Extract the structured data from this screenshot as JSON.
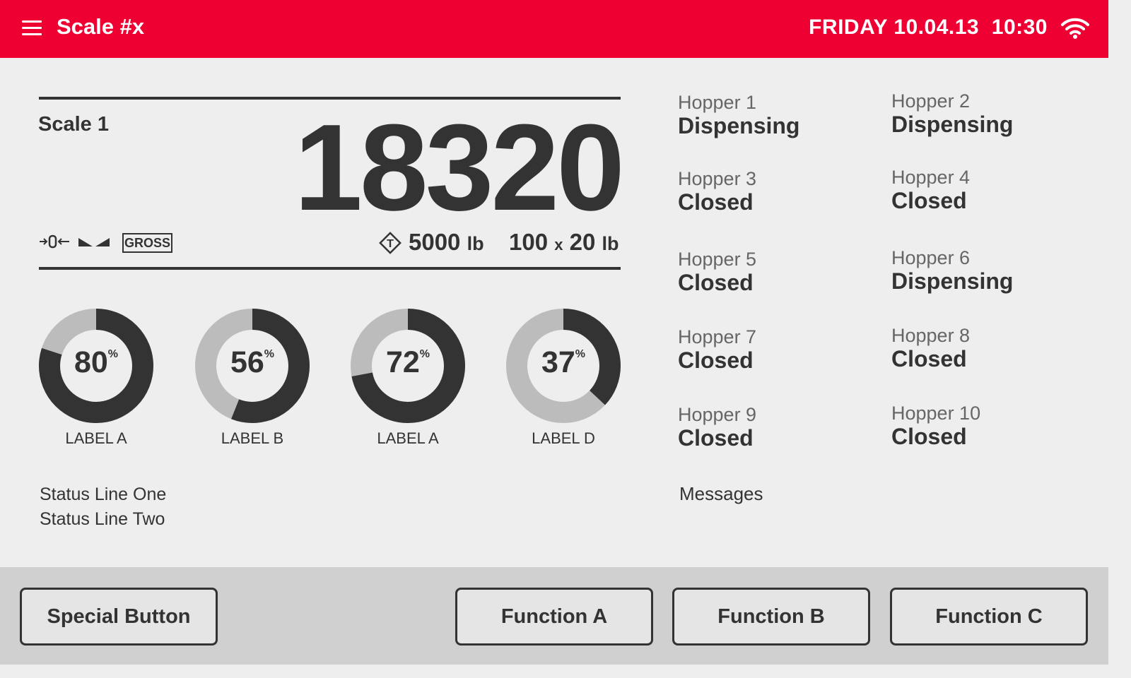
{
  "header": {
    "title": "Scale #x",
    "datetime": "FRIDAY 10.04.13  10:30",
    "wifi_icon": "wifi-icon"
  },
  "scale": {
    "name": "Scale 1",
    "weight": "18320",
    "mode": "GROSS",
    "capacity": "5000",
    "capacity_unit": "lb",
    "divisions": "100",
    "times": "x",
    "division_size": "20",
    "division_unit": "lb",
    "zero_icon": "center-of-zero-icon",
    "stable_icon": "motion-icon",
    "tare_icon": "tare-icon"
  },
  "gauges": [
    {
      "value": 80,
      "display": "80",
      "pct": "%",
      "label": "LABEL A"
    },
    {
      "value": 56,
      "display": "56",
      "pct": "%",
      "label": "LABEL B"
    },
    {
      "value": 72,
      "display": "72",
      "pct": "%",
      "label": "LABEL A"
    },
    {
      "value": 37,
      "display": "37",
      "pct": "%",
      "label": "LABEL D"
    }
  ],
  "status": {
    "line1": "Status Line One",
    "line2": "Status Line Two"
  },
  "hoppers": [
    {
      "name": "Hopper 1",
      "state": "Dispensing"
    },
    {
      "name": "Hopper 2",
      "state": "Dispensing"
    },
    {
      "name": "Hopper 3",
      "state": "Closed"
    },
    {
      "name": "Hopper 4",
      "state": "Closed"
    },
    {
      "name": "Hopper 5",
      "state": "Closed"
    },
    {
      "name": "Hopper 6",
      "state": "Dispensing"
    },
    {
      "name": "Hopper 7",
      "state": "Closed"
    },
    {
      "name": "Hopper 8",
      "state": "Closed"
    },
    {
      "name": "Hopper 9",
      "state": "Closed"
    },
    {
      "name": "Hopper 10",
      "state": "Closed"
    }
  ],
  "messages": "Messages",
  "buttons": {
    "special": "Special Button",
    "function_a": "Function A",
    "function_b": "Function B",
    "function_c": "Function C"
  },
  "colors": {
    "header": "#ef0033",
    "gauge_fill": "#333333",
    "gauge_track": "#bdbcbd"
  }
}
